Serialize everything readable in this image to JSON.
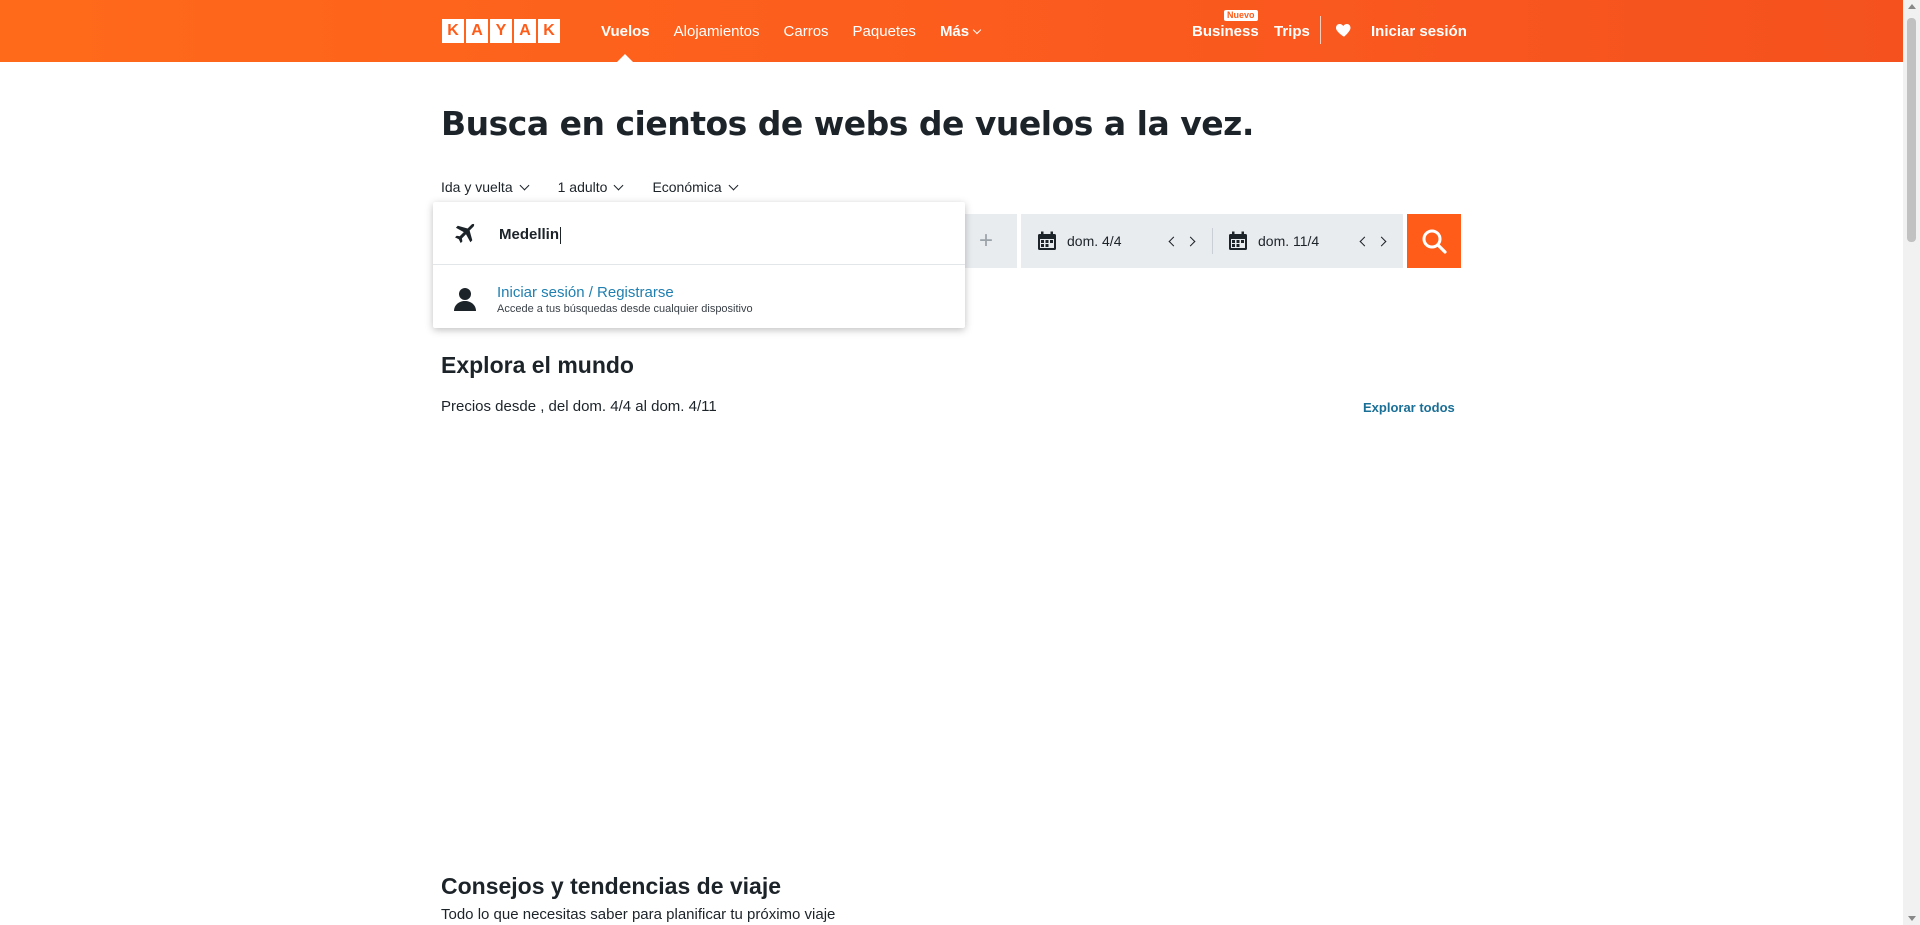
{
  "header": {
    "logo_letters": [
      "K",
      "A",
      "Y",
      "A",
      "K"
    ],
    "nav": {
      "vuelos": "Vuelos",
      "alojamientos": "Alojamientos",
      "carros": "Carros",
      "paquetes": "Paquetes",
      "mas": "Más"
    },
    "business": "Business",
    "business_badge": "Nuevo",
    "trips": "Trips",
    "login": "Iniciar sesión",
    "brand_color": "#ff5c1a"
  },
  "hero": {
    "headline": "Busca en cientos de webs de vuelos a la vez.",
    "trip_type": "Ida y vuelta",
    "passengers": "1 adulto",
    "cabin": "Económica"
  },
  "search": {
    "origin_value": "Medellin",
    "add_icon": "+",
    "depart_date": "dom. 4/4",
    "return_date": "dom. 11/4"
  },
  "dropdown": {
    "signin_title": "Iniciar sesión / Registrarse",
    "signin_subtitle": "Accede a tus búsquedas desde cualquier dispositivo"
  },
  "explore": {
    "title": "Explora el mundo",
    "subtitle": "Precios desde , del dom. 4/4 al dom. 4/11",
    "explore_all": "Explorar todos"
  },
  "tips": {
    "title": "Consejos y tendencias de viaje",
    "subtitle": "Todo lo que necesitas saber para planificar tu próximo viaje"
  }
}
